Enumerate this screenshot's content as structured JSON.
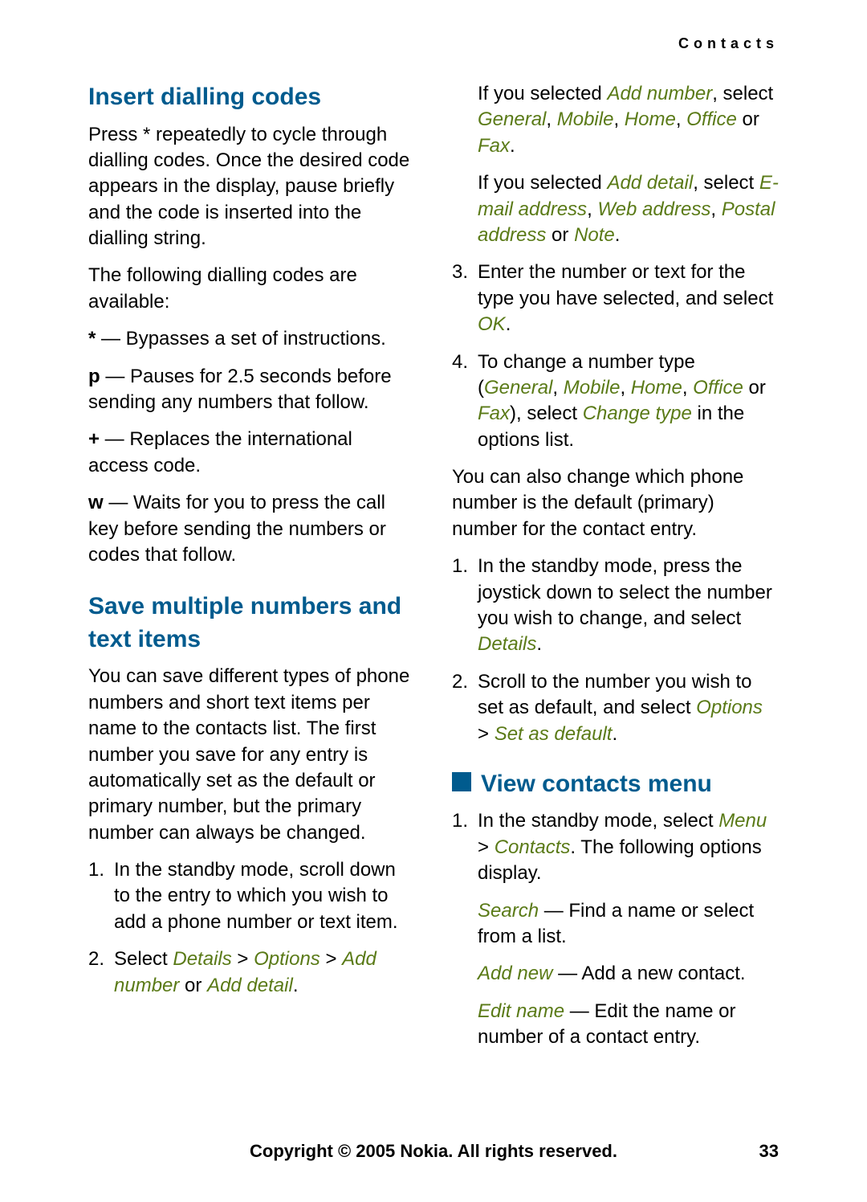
{
  "runningHeader": "Contacts",
  "left": {
    "h1": "Insert dialling codes",
    "intro": "Press * repeatedly to cycle through dialling codes. Once the desired code appears in the display, pause briefly and the code is inserted into the dialling string.",
    "available": "The following dialling codes are available:",
    "codes": {
      "star": {
        "sym": "*",
        "desc": " — Bypasses a set of instructions."
      },
      "p": {
        "sym": "p",
        "desc": " — Pauses for 2.5 seconds before sending any numbers that follow."
      },
      "plus": {
        "sym": "+",
        "desc": " — Replaces the international access code."
      },
      "w": {
        "sym": "w",
        "desc": " — Waits for you to press the call key before sending the numbers or codes that follow."
      }
    },
    "h2": "Save multiple numbers and text items",
    "savePara": "You can save different types of phone numbers and short text items per name to the contacts list. The first number you save for any entry is automatically set as the default or primary number, but the primary number can always be changed.",
    "step1": "In the standby mode, scroll down to the entry to which you wish to add a phone number or text item.",
    "step2_a": "Select ",
    "step2_b": "Details",
    "step2_c": " > ",
    "step2_d": "Options",
    "step2_e": " > ",
    "step2_f": "Add number",
    "step2_g": " or ",
    "step2_h": "Add detail",
    "step2_i": "."
  },
  "right": {
    "addNum_a": "If you selected ",
    "addNum_b": "Add number",
    "addNum_c": ", select ",
    "addNum_d": "General",
    "addNum_e": ", ",
    "addNum_f": "Mobile",
    "addNum_g": ", ",
    "addNum_h": "Home",
    "addNum_i": ", ",
    "addNum_j": "Office",
    "addNum_k": " or ",
    "addNum_l": "Fax",
    "addNum_m": ".",
    "addDet_a": "If you selected ",
    "addDet_b": "Add detail",
    "addDet_c": ", select ",
    "addDet_d": "E-mail address",
    "addDet_e": ", ",
    "addDet_f": "Web address",
    "addDet_g": ", ",
    "addDet_h": "Postal address",
    "addDet_i": " or ",
    "addDet_j": "Note",
    "addDet_k": ".",
    "step3_a": "Enter the number or text for the type you have selected, and select ",
    "step3_b": "OK",
    "step3_c": ".",
    "step4_a": "To change a number type (",
    "step4_b": "General",
    "step4_c": ", ",
    "step4_d": "Mobile",
    "step4_e": ", ",
    "step4_f": "Home",
    "step4_g": ", ",
    "step4_h": "Office",
    "step4_i": " or ",
    "step4_j": "Fax",
    "step4_k": "), select ",
    "step4_l": "Change type",
    "step4_m": " in the options list.",
    "defaultPara": "You can also change which phone number is the default (primary) number for the contact entry.",
    "d1_a": "In the standby mode, press the joystick down to select the number you wish to change, and select ",
    "d1_b": "Details",
    "d1_c": ".",
    "d2_a": "Scroll to the number you wish to set as default, and select ",
    "d2_b": "Options",
    "d2_c": " > ",
    "d2_d": "Set as default",
    "d2_e": ".",
    "h3": "View contacts menu",
    "v1_a": "In the standby mode, select ",
    "v1_b": "Menu",
    "v1_c": " > ",
    "v1_d": "Contacts",
    "v1_e": ". The following options display.",
    "search_a": "Search",
    "search_b": " — Find a name or select from a list.",
    "addnew_a": "Add new ",
    "addnew_b": " — Add a new contact.",
    "edit_a": "Edit name",
    "edit_b": " — Edit the name or number of a contact entry."
  },
  "footer": {
    "copyright": "Copyright © 2005 Nokia. All rights reserved.",
    "page": "33"
  }
}
